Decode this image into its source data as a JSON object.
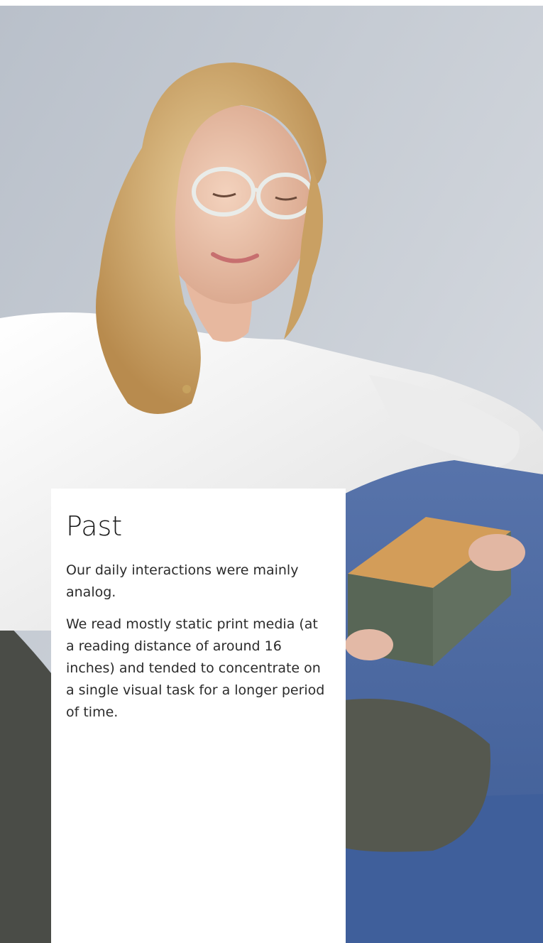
{
  "card": {
    "title": "Past",
    "paragraphs": [
      "Our daily interactions were mainly analog.",
      "We read mostly static print media (at a reading distance of around 16 inches) and tended to concentrate on a single visual task for a longer period of time."
    ]
  },
  "colors": {
    "background": "#ffffff",
    "wall": "#c9ced6",
    "sofa": "#4a6aa3",
    "blouse": "#f2f2f0",
    "hair": "#d9b57a",
    "trousers": "#4f524a",
    "book_edge": "#d19a56",
    "book_cover": "#5e6b5e",
    "text": "#2b2b2b"
  }
}
